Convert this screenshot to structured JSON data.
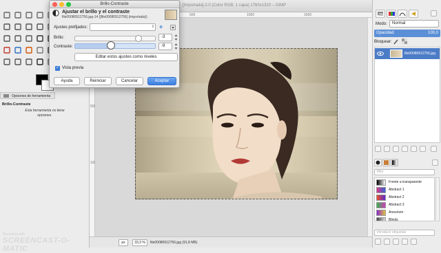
{
  "image_window": {
    "title": "[Importada]-2.0 (Color RGB, 1 capa) 1760x1320 – GIMP",
    "ruler_top_ticks": [
      "0",
      "500",
      "1000",
      "1500"
    ],
    "ruler_left_ticks": [
      "0",
      "500",
      "1000"
    ],
    "status": {
      "unit": "px",
      "zoom": "33,3 %",
      "file_info": "file00080912756.jpg (91,8 MB)"
    }
  },
  "toolbox": {
    "tool_options_tab": "Opciones de herramienta",
    "tool_options_title": "Brillo-Contraste",
    "tool_options_message": "Esta herramienta no tiene opciones."
  },
  "dialog": {
    "title": "Brillo-Contraste",
    "header_title": "Ajustar el brillo y el contraste",
    "header_subtitle": "file00080912756.jpg-14 ([file00080912756] (importada))",
    "presets_label": "Ajustes prefijados:",
    "presets_value": "",
    "brightness_label": "Brillo:",
    "brightness_value": "-3",
    "brightness_level": -3,
    "contrast_label": "Contraste:",
    "contrast_value": "-9",
    "contrast_level": -9,
    "levels_button": "Editar estos ajustes como niveles",
    "preview_label": "Vista previa",
    "preview_checked": true,
    "help_button": "Ayuda",
    "reset_button": "Reiniciar",
    "cancel_button": "Cancelar",
    "ok_button": "Aceptar"
  },
  "layers_dock": {
    "mode_label": "Modo:",
    "mode_value": "Normal",
    "opacity_label": "Opacidad",
    "opacity_value": "100,0",
    "lock_label": "Bloquear:",
    "layer_name": "file00080912756.jpg"
  },
  "gradients_dock": {
    "filter_placeholder": "filtro",
    "tag_placeholder": "introducir etiquetas",
    "items": [
      {
        "name": "Frente a transparente",
        "colors": [
          "#000000",
          "#ffffff"
        ]
      },
      {
        "name": "Abstract 1",
        "colors": [
          "#d23a8c",
          "#3a62d2"
        ]
      },
      {
        "name": "Abstract 2",
        "colors": [
          "#e84f2a",
          "#5f2ad0"
        ]
      },
      {
        "name": "Abstract 3",
        "colors": [
          "#3ab34a",
          "#d23ac0"
        ]
      },
      {
        "name": "Aneurism",
        "colors": [
          "#8a2ad0",
          "#e0c040"
        ]
      },
      {
        "name": "Blinds",
        "colors": [
          "#444444",
          "#dddddd"
        ]
      }
    ]
  },
  "watermark": {
    "top": "Recorded with",
    "brand": "SCREENCAST-O-MATIC"
  },
  "colors": {
    "accent": "#3d7fe0",
    "selected_layer": "#4d7cc7",
    "traffic_close": "#fc5f57",
    "traffic_min": "#fdbc2e",
    "traffic_max": "#28c840"
  }
}
